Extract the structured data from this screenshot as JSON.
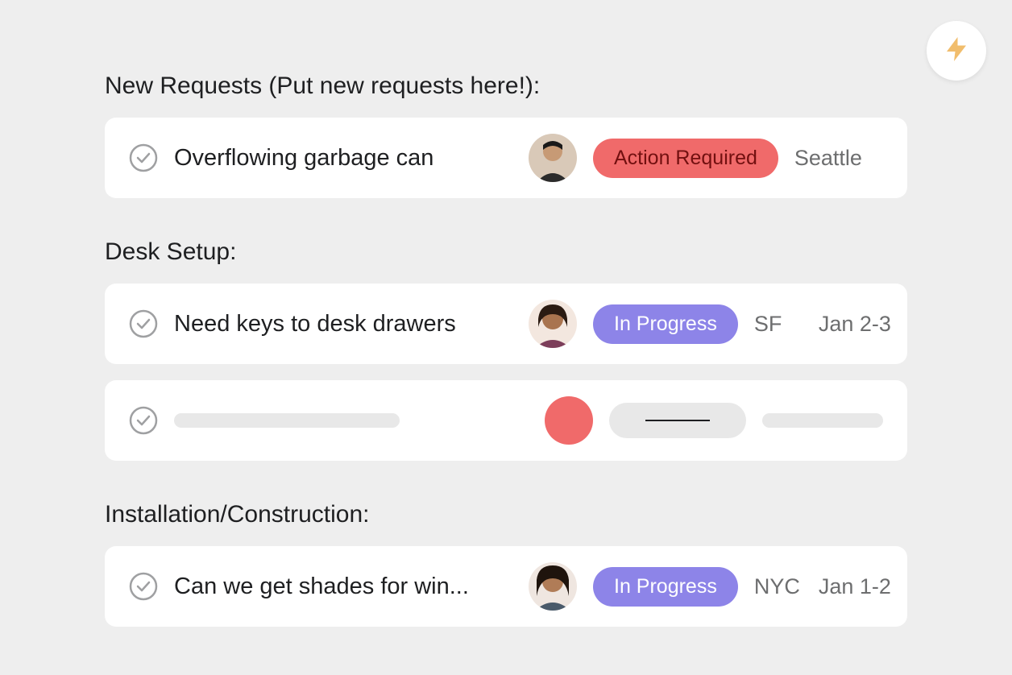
{
  "fab_icon": "lightning-bolt-icon",
  "sections": [
    {
      "title": "New Requests (Put new requests here!):",
      "tasks": [
        {
          "title": "Overflowing garbage can",
          "status_label": "Action Required",
          "status_color": "red",
          "location": "Seattle",
          "date": "",
          "avatar": "person1",
          "placeholder": false
        }
      ]
    },
    {
      "title": "Desk Setup:",
      "tasks": [
        {
          "title": "Need keys to desk drawers",
          "status_label": "In Progress",
          "status_color": "purple",
          "location": "SF",
          "date": "Jan 2-3",
          "avatar": "person2",
          "placeholder": false
        },
        {
          "placeholder": true
        }
      ]
    },
    {
      "title": "Installation/Construction:",
      "tasks": [
        {
          "title": "Can we get shades for win...",
          "status_label": "In Progress",
          "status_color": "purple",
          "location": "NYC",
          "date": "Jan 1-2",
          "avatar": "person3",
          "placeholder": false
        }
      ]
    }
  ]
}
